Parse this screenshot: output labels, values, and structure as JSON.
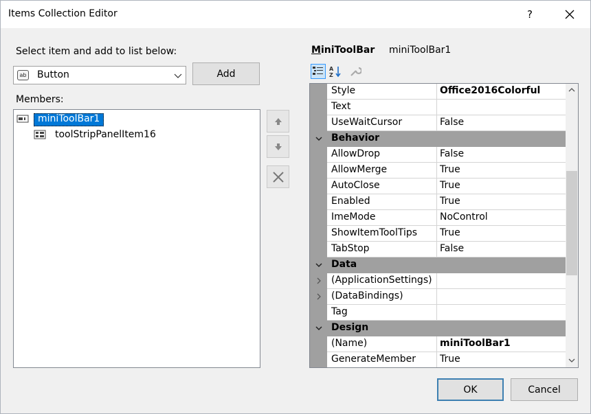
{
  "window": {
    "title": "Items Collection Editor",
    "help_label": "?",
    "close_label": "✕"
  },
  "select_label": "Select item and add to list below:",
  "combo": {
    "icon_text": "ab",
    "selected": "Button"
  },
  "add_label": "Add",
  "members_label": "Members:",
  "members": [
    {
      "label": "miniToolBar1",
      "selected": true
    },
    {
      "label": "toolStripPanelItem16",
      "selected": false
    }
  ],
  "property_grid": {
    "object_type_first": "M",
    "object_type_rest": "iniToolBar",
    "object_name": "miniToolBar1",
    "rows": [
      {
        "kind": "prop",
        "name": "Style",
        "value": "Office2016Colorful",
        "bold": true
      },
      {
        "kind": "prop",
        "name": "Text",
        "value": ""
      },
      {
        "kind": "prop",
        "name": "UseWaitCursor",
        "value": "False"
      },
      {
        "kind": "category",
        "name": "Behavior"
      },
      {
        "kind": "prop",
        "name": "AllowDrop",
        "value": "False"
      },
      {
        "kind": "prop",
        "name": "AllowMerge",
        "value": "True"
      },
      {
        "kind": "prop",
        "name": "AutoClose",
        "value": "True"
      },
      {
        "kind": "prop",
        "name": "Enabled",
        "value": "True"
      },
      {
        "kind": "prop",
        "name": "ImeMode",
        "value": "NoControl"
      },
      {
        "kind": "prop",
        "name": "ShowItemToolTips",
        "value": "True"
      },
      {
        "kind": "prop",
        "name": "TabStop",
        "value": "False"
      },
      {
        "kind": "category",
        "name": "Data"
      },
      {
        "kind": "prop",
        "name": "(ApplicationSettings)",
        "value": "",
        "expandable": true
      },
      {
        "kind": "prop",
        "name": "(DataBindings)",
        "value": "",
        "expandable": true
      },
      {
        "kind": "prop",
        "name": "Tag",
        "value": ""
      },
      {
        "kind": "category",
        "name": "Design"
      },
      {
        "kind": "prop",
        "name": "(Name)",
        "value": "miniToolBar1",
        "bold": true
      },
      {
        "kind": "prop",
        "name": "GenerateMember",
        "value": "True"
      }
    ]
  },
  "ok_label": "OK",
  "cancel_label": "Cancel"
}
